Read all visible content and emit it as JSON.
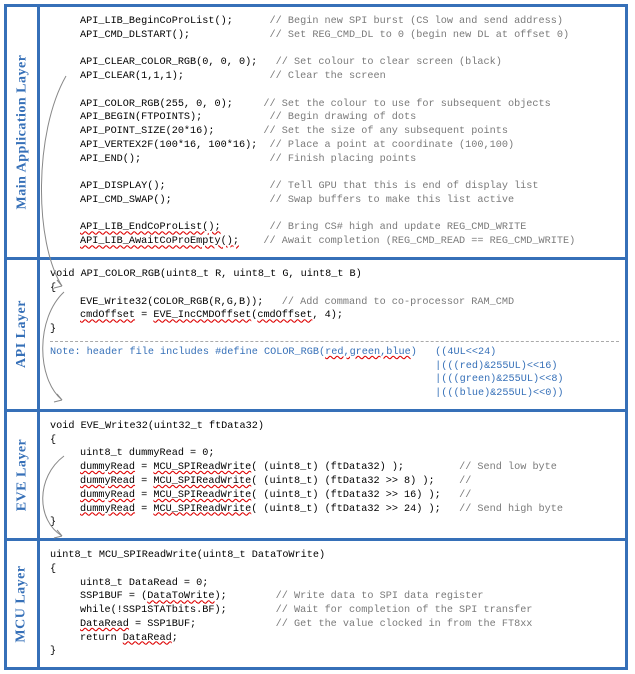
{
  "labels": {
    "main": "Main Application Layer",
    "api": "API Layer",
    "eve": "EVE Layer",
    "mcu": "MCU Layer"
  },
  "main_layer": {
    "l1_code": "API_LIB_BeginCoProList();",
    "l1_cmt": "// Begin new SPI burst (CS low and send address)",
    "l2_code": "API_CMD_DLSTART();",
    "l2_cmt": "// Set REG_CMD_DL to 0 (begin new DL at offset 0)",
    "l3_code": "API_CLEAR_COLOR_RGB(0, 0, 0);",
    "l3_cmt": "// Set colour to clear screen (black)",
    "l4_code": "API_CLEAR(1,1,1);",
    "l4_cmt": "// Clear the screen",
    "l5_code": "API_COLOR_RGB(255, 0, 0);",
    "l5_cmt": "// Set the colour to use for subsequent objects",
    "l6_code": "API_BEGIN(FTPOINTS);",
    "l6_cmt": "// Begin drawing of dots",
    "l7_code": "API_POINT_SIZE(20*16);",
    "l7_cmt": "// Set the size of any subsequent points",
    "l8_code": "API_VERTEX2F(100*16, 100*16);",
    "l8_cmt": "// Place a point at coordinate (100,100)",
    "l9_code": "API_END();",
    "l9_cmt": "// Finish placing points",
    "l10_code": "API_DISPLAY();",
    "l10_cmt": "// Tell GPU that this is end of display list",
    "l11_code": "API_CMD_SWAP();",
    "l11_cmt": "// Swap buffers to make this list active",
    "l12_code": "API_LIB_EndCoProList();",
    "l12_cmt": "// Bring CS# high and update REG_CMD_WRITE",
    "l13_code": "API_LIB_AwaitCoProEmpty();",
    "l13_cmt": "// Await completion (REG_CMD_READ == REG_CMD_WRITE)"
  },
  "api_layer": {
    "sig": "void API_COLOR_RGB(uint8_t R, uint8_t G, uint8_t B)",
    "open": "{",
    "b1": "EVE_Write32(COLOR_RGB(R,G,B));",
    "b1_cmt": "// Add command to co-processor RAM_CMD",
    "b2a": "cmdOffset",
    "b2b": " = ",
    "b2c": "EVE_IncCMDOffset",
    "b2d": "(",
    "b2e": "cmdOffset",
    "b2f": ", 4);",
    "close": "}",
    "note_pre": "Note: header file includes #define COLOR_RGB(",
    "note_args": "red,green,blue",
    "note_post": ")   ((4UL<<24)",
    "note2": "|(((red)&255UL)<<16)",
    "note3": "|(((green)&255UL)<<8)",
    "note4": "|(((blue)&255UL)<<0))"
  },
  "eve_layer": {
    "sig": "void EVE_Write32(uint32_t ftData32)",
    "open": "{",
    "v1": "uint8_t dummyRead = 0;",
    "d1a": "dummyRead",
    "d1b": " = ",
    "d1c": "MCU_SPIReadWrite",
    "d1d": "( (uint8_t) (ftData32) );",
    "d1_cmt": "// Send low byte",
    "d2a": "dummyRead",
    "d2b": " = ",
    "d2c": "MCU_SPIReadWrite",
    "d2d": "( (uint8_t) (ftData32 >> 8) );",
    "d2_cmt": "//",
    "d3a": "dummyRead",
    "d3b": " = ",
    "d3c": "MCU_SPIReadWrite",
    "d3d": "( (uint8_t) (ftData32 >> 16) );",
    "d3_cmt": "//",
    "d4a": "dummyRead",
    "d4b": " = ",
    "d4c": "MCU_SPIReadWrite",
    "d4d": "( (uint8_t) (ftData32 >> 24) );",
    "d4_cmt": "// Send high byte",
    "close": "}"
  },
  "mcu_layer": {
    "sig": "uint8_t MCU_SPIReadWrite(uint8_t DataToWrite)",
    "open": "{",
    "v1": "uint8_t DataRead = 0;",
    "s1a": "SSP1BUF = (",
    "s1b": "DataToWrite",
    "s1c": ");",
    "s1_cmt": "// Write data to SPI data register",
    "s2": "while(!SSP1STATbits.BF);",
    "s2_cmt": "// Wait for completion of the SPI transfer",
    "s3a": "DataRead",
    "s3b": " = SSP1BUF;",
    "s3_cmt": "// Get the value clocked in from the FT8xx",
    "s4a": "return ",
    "s4b": "DataRead",
    "s4c": ";",
    "close": "}"
  }
}
